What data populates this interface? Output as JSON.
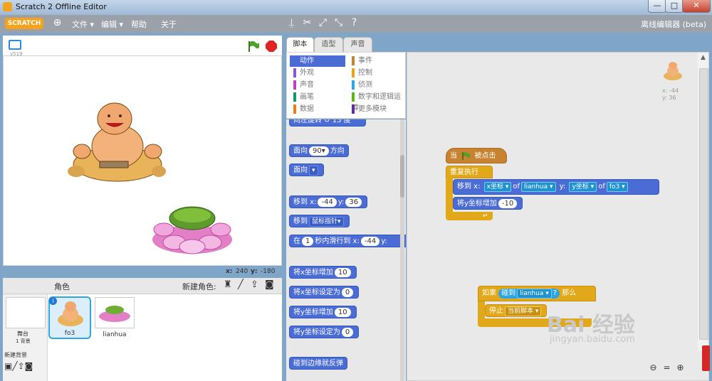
{
  "window": {
    "title": "Scratch 2 Offline Editor",
    "min": "—",
    "max": "□",
    "close": "✕"
  },
  "menu": {
    "logo": "SCRATCH",
    "items": [
      "文件 ▾",
      "编辑 ▾",
      "帮助",
      "关于"
    ],
    "offline_label": "离线编辑器 (beta)"
  },
  "stage": {
    "version": "v519",
    "coord_x_label": "x:",
    "coord_x": "240",
    "coord_y_label": "y:",
    "coord_y": "-180"
  },
  "sprites": {
    "header": "角色",
    "new_sprite_label": "新建角色:",
    "stage_label": "舞台",
    "stage_backdrops": "1 背景",
    "new_backdrop_label": "新建背景",
    "list": [
      {
        "name": "fo3"
      },
      {
        "name": "lianhua"
      }
    ]
  },
  "tabs": [
    "脚本",
    "造型",
    "声音"
  ],
  "categories": [
    {
      "label": "动作",
      "color": "#4a6cd4"
    },
    {
      "label": "事件",
      "color": "#c88330"
    },
    {
      "label": "外观",
      "color": "#8a55d7"
    },
    {
      "label": "控制",
      "color": "#e1a91a"
    },
    {
      "label": "声音",
      "color": "#bb42c3"
    },
    {
      "label": "侦测",
      "color": "#2ca5e2"
    },
    {
      "label": "画笔",
      "color": "#0e9a6c"
    },
    {
      "label": "数字和逻辑运算",
      "color": "#5cb712"
    },
    {
      "label": "数据",
      "color": "#ee7d16"
    },
    {
      "label": "更多模块",
      "color": "#632d99"
    }
  ],
  "palette": {
    "turn_partial": "向左旋转 ↺ 15 度",
    "point_dir": "面向",
    "point_dir_val": "90▾",
    "point_dir_unit": "方向",
    "point_towards": "面向",
    "point_towards_val": "▾",
    "goto_xy": "移到 x:",
    "goto_x": "-44",
    "goto_y_label": "y:",
    "goto_y": "36",
    "goto_target": "移到",
    "goto_target_val": "鼠标指针▾",
    "glide_pre": "在",
    "glide_secs": "1",
    "glide_mid": "秒内滑行到 x:",
    "glide_x": "-44",
    "glide_y": "y:",
    "change_x": "将x坐标增加",
    "change_x_val": "10",
    "set_x": "将x坐标设定为",
    "set_x_val": "0",
    "change_y": "将y坐标增加",
    "change_y_val": "10",
    "set_y": "将y坐标设定为",
    "set_y_val": "0",
    "bounce": "碰到边缘就反弹"
  },
  "script1": {
    "hat_pre": "当",
    "hat_post": "被点击",
    "forever": "重复执行",
    "goto": "移到 x:",
    "goto_x_attr": "x坐标 ▾",
    "of1": "of",
    "goto_x_obj": "lianhua ▾",
    "goto_y": "y:",
    "goto_y_attr": "y坐标 ▾",
    "of2": "of",
    "goto_y_obj": "fo3 ▾",
    "change_y": "将y坐标增加",
    "change_y_val": "-10"
  },
  "script2": {
    "if": "如果",
    "touching": "碰到",
    "touching_obj": "lianhua ▾",
    "q": "?",
    "then": "那么",
    "stop": "停止",
    "stop_opt": "当前脚本 ▾"
  },
  "sprite_info": {
    "x": "x: -44",
    "y": "y: 36"
  },
  "watermark": {
    "main": "Bai 经验",
    "url": "jingyan.baidu.com"
  }
}
